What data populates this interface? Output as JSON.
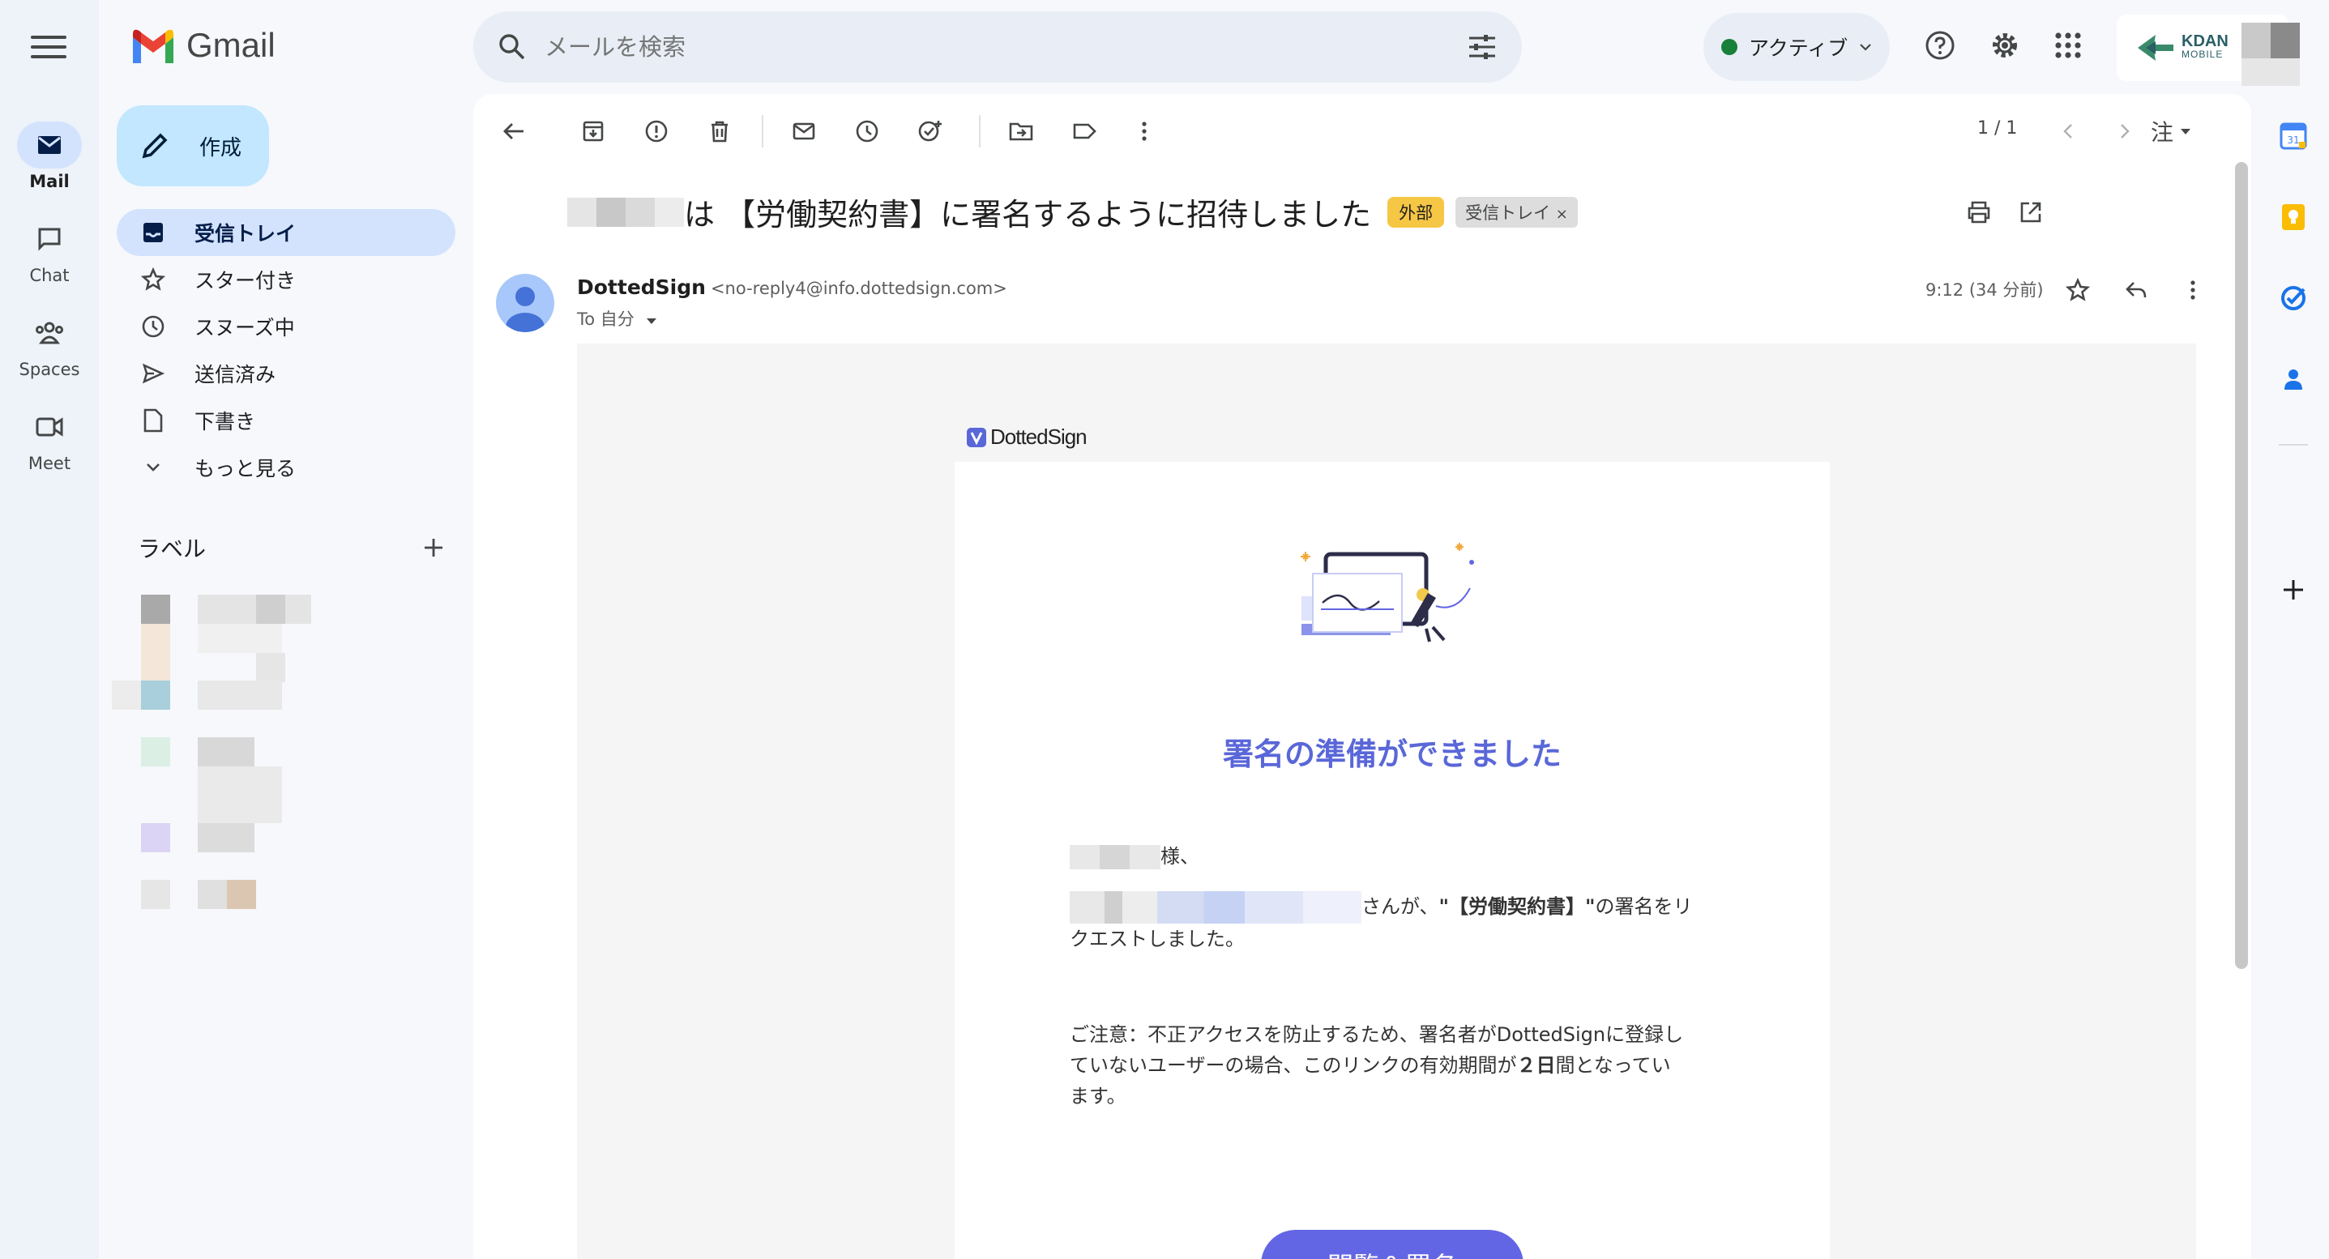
{
  "app": {
    "name": "Gmail"
  },
  "rail": [
    {
      "label": "Mail",
      "icon": "mail-icon",
      "active": true
    },
    {
      "label": "Chat",
      "icon": "chat-icon"
    },
    {
      "label": "Spaces",
      "icon": "spaces-icon"
    },
    {
      "label": "Meet",
      "icon": "meet-icon"
    }
  ],
  "compose": {
    "label": "作成"
  },
  "nav": [
    {
      "label": "受信トレイ",
      "icon": "inbox-icon",
      "active": true
    },
    {
      "label": "スター付き",
      "icon": "star-icon"
    },
    {
      "label": "スヌーズ中",
      "icon": "clock-icon"
    },
    {
      "label": "送信済み",
      "icon": "send-icon"
    },
    {
      "label": "下書き",
      "icon": "draft-icon"
    },
    {
      "label": "もっと見る",
      "icon": "chevron-down-icon"
    }
  ],
  "labels": {
    "title": "ラベル"
  },
  "search": {
    "placeholder": "メールを検索"
  },
  "status": {
    "label": "アクティブ",
    "color": "#188038"
  },
  "account": {
    "logo_text_1": "KDAN",
    "logo_text_2": "MOBILE"
  },
  "toolbar": {
    "count": "1 / 1",
    "lang": "注"
  },
  "email": {
    "subject": "は 【労働契約書】に署名するように招待しました",
    "tag_external": "外部",
    "tag_inbox": "受信トレイ",
    "sender_name": "DottedSign",
    "sender_addr": "<no-reply4@info.dottedsign.com>",
    "to": "To 自分",
    "time": "9:12 (34 分前)"
  },
  "body": {
    "logo": "DottedSign",
    "title": "署名の準備ができました",
    "greeting_suffix": "様、",
    "request_mid": "さんが、",
    "request_bold": "\"【労働契約書】\"",
    "request_end": "の署名をリ",
    "request_line2": "クエストしました。",
    "notice_line1": "ご注意：不正アクセスを防止するため、署名者がDottedSignに登録し",
    "notice_line2_a": "ていないユーザーの場合、このリンクの有効期間が",
    "notice_line2_b": "２日",
    "notice_line2_c": "間となってい",
    "notice_line3": "ます。",
    "button": "閲覧＆署名",
    "accent": "#5a67d8",
    "button_color": "#6366e4"
  }
}
